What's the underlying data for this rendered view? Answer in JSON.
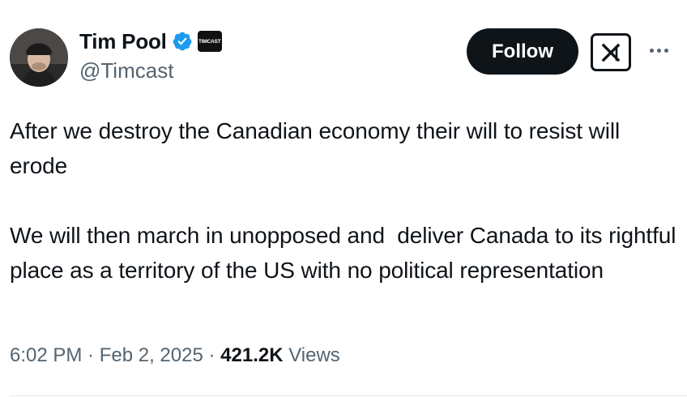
{
  "author": {
    "display_name": "Tim Pool",
    "handle": "@Timcast",
    "affiliate_badge_text": "TIMCAST",
    "verified": true,
    "verified_icon": "verified-badge-icon",
    "avatar_icon": "profile-avatar-beanie"
  },
  "actions": {
    "follow_label": "Follow",
    "grok_icon": "grok-icon",
    "more_icon": "more-options-icon"
  },
  "tweet": {
    "text": "After we destroy the Canadian economy their will to resist will erode\n\nWe will then march in unopposed and  deliver Canada to its rightful place as a territory of the US with no political representation"
  },
  "meta": {
    "time": "6:02 PM",
    "separator": " · ",
    "date": "Feb 2, 2025",
    "views_count": "421.2K",
    "views_label": " Views"
  },
  "colors": {
    "text_primary": "#0f1419",
    "text_secondary": "#536471",
    "verified_blue": "#1d9bf0",
    "follow_bg": "#0f1419"
  }
}
